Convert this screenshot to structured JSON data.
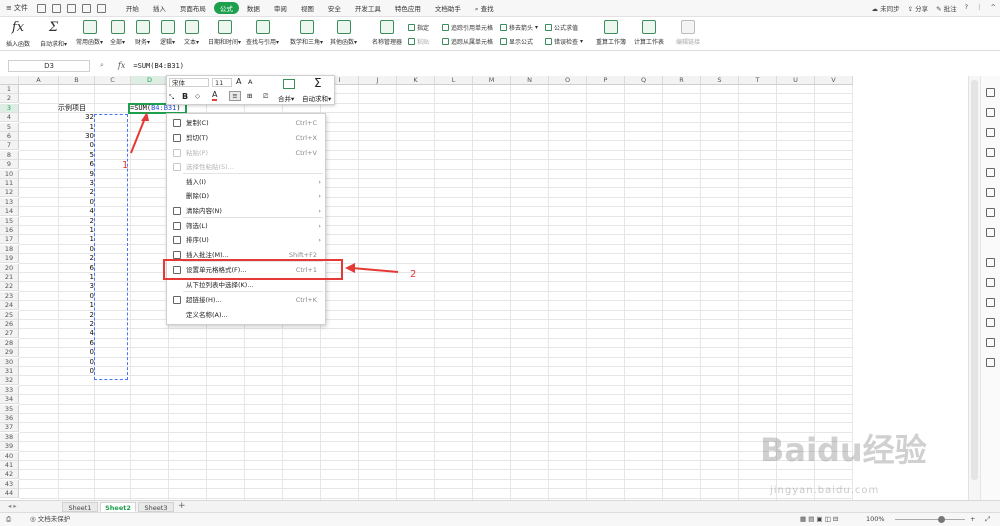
{
  "topbar": {
    "file_label": "文件",
    "tabs": [
      "开始",
      "插入",
      "页面布局",
      "公式",
      "数据",
      "审阅",
      "视图",
      "安全",
      "开发工具",
      "特色应用",
      "文档助手"
    ],
    "active_tab": "公式",
    "search_label": "查找",
    "right": {
      "sync": "未同步",
      "share": "分享",
      "annotate": "批注",
      "help": "?"
    }
  },
  "ribbon": {
    "insert_fn": "插入函数",
    "autosum": "自动求和",
    "common": "常用函数",
    "all": "全部",
    "finance": "财务",
    "logic": "逻辑",
    "text": "文本",
    "datetime": "日期和时间",
    "lookup": "查找与引用",
    "math": "数学和三角",
    "other": "其他函数",
    "name_mgr": "名称管理器",
    "specify": "指定",
    "paste": "粘贴",
    "trace_prec": "追踪引用单元格",
    "trace_dep": "追踪从属单元格",
    "remove_arrows": "移去箭头",
    "show_formula": "显示公式",
    "formula_eval": "公式求值",
    "error_check": "错误检查",
    "recalc_wb": "重算工作簿",
    "calc_sheet": "计算工作表",
    "edit_link": "编辑链接"
  },
  "formula_bar": {
    "name_box": "D3",
    "fx": "fx",
    "formula": "=SUM(B4:B31)"
  },
  "columns": [
    "A",
    "B",
    "C",
    "D",
    "E",
    "F",
    "G",
    "H",
    "I",
    "J",
    "K",
    "L",
    "M",
    "N",
    "O",
    "P",
    "Q",
    "R",
    "S",
    "T",
    "U",
    "V"
  ],
  "rows_count": 44,
  "sheet": {
    "header_label": "示例项目",
    "values": [
      "32",
      "1",
      "30",
      "0",
      "5",
      "6",
      "9",
      "3",
      "2",
      "0",
      "4",
      "2",
      "1",
      "1",
      "0",
      "2",
      "6",
      "1",
      "3",
      "0",
      "1",
      "2",
      "2",
      "4",
      "6",
      "0",
      "0",
      "0"
    ]
  },
  "active_cell_formula": {
    "prefix": "=SUM(",
    "ref": "B4:B31",
    "suffix": ")"
  },
  "mini_toolbar": {
    "font": "宋体",
    "size": "11",
    "merge": "合并",
    "autosum": "自动求和"
  },
  "context_menu": [
    {
      "label": "复制(C)",
      "shortcut": "Ctrl+C",
      "disabled": false
    },
    {
      "label": "剪切(T)",
      "shortcut": "Ctrl+X",
      "disabled": false
    },
    {
      "label": "粘贴(P)",
      "shortcut": "Ctrl+V",
      "disabled": true
    },
    {
      "label": "选择性粘贴(S)...",
      "shortcut": "",
      "disabled": true
    },
    {
      "label": "插入(I)",
      "shortcut": "",
      "disabled": false,
      "arrow": true
    },
    {
      "label": "删除(D)",
      "shortcut": "",
      "disabled": false,
      "arrow": true
    },
    {
      "label": "清除内容(N)",
      "shortcut": "",
      "disabled": false,
      "arrow": true
    },
    {
      "label": "筛选(L)",
      "shortcut": "",
      "disabled": false,
      "arrow": true
    },
    {
      "label": "排序(U)",
      "shortcut": "",
      "disabled": false,
      "arrow": true
    },
    {
      "label": "插入批注(M)...",
      "shortcut": "Shift+F2",
      "disabled": false
    },
    {
      "label": "设置单元格格式(F)...",
      "shortcut": "Ctrl+1",
      "disabled": false
    },
    {
      "label": "从下拉列表中选择(K)...",
      "shortcut": "",
      "disabled": false
    },
    {
      "label": "超链接(H)...",
      "shortcut": "Ctrl+K",
      "disabled": false
    },
    {
      "label": "定义名称(A)...",
      "shortcut": "",
      "disabled": false
    }
  ],
  "annotations": {
    "one": "1",
    "two": "2"
  },
  "sheet_tabs": [
    "Sheet1",
    "Sheet2",
    "Sheet3"
  ],
  "active_sheet": "Sheet2",
  "status": {
    "protect": "文档未保护",
    "zoom": "100%"
  },
  "watermark": {
    "brand": "Baidu经验",
    "url": "jingyan.baidu.com"
  },
  "colors": {
    "accent": "#1d9f4d",
    "annotation": "#e53935",
    "ref": "#2a4fd8"
  }
}
